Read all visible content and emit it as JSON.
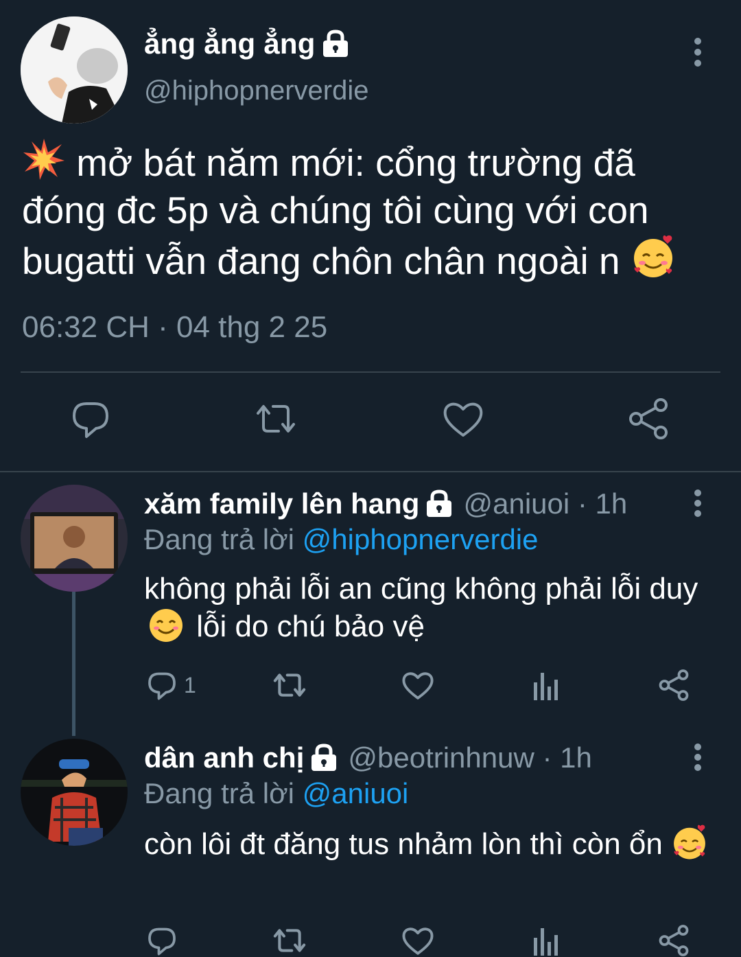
{
  "main_tweet": {
    "display_name": "ẳng ẳng ẳng",
    "handle": "@hiphopnerverdie",
    "text": "mở bát năm mới: cổng trường đã đóng đc 5p và chúng tôi cùng với con bugatti vẫn đang chôn chân ngoài n",
    "timestamp": "06:32 CH · 04 thg 2 25",
    "leading_emoji": "collision-emoji",
    "trailing_emoji": "smiling-face-with-hearts-emoji"
  },
  "replies": [
    {
      "display_name": "xăm family lên hang",
      "handle": "@aniuoi · 1h",
      "replying_prefix": "Đang trả lời",
      "replying_to": "@hiphopnerverdie",
      "text_part1": "không phải lỗi an cũng không phải lỗi duy",
      "text_part2": "lỗi do chú bảo vệ",
      "reply_count": "1"
    },
    {
      "display_name": "dân anh chị",
      "handle": "@beotrinhnuw · 1h",
      "replying_prefix": "Đang trả lời",
      "replying_to": "@aniuoi",
      "text": "còn lôi đt đăng tus nhảm lòn thì còn ổn",
      "reply_count": ""
    }
  ],
  "colors": {
    "background": "#15202b",
    "secondary_text": "#8899a6",
    "mention": "#1da1f2",
    "divider": "#38444d"
  }
}
